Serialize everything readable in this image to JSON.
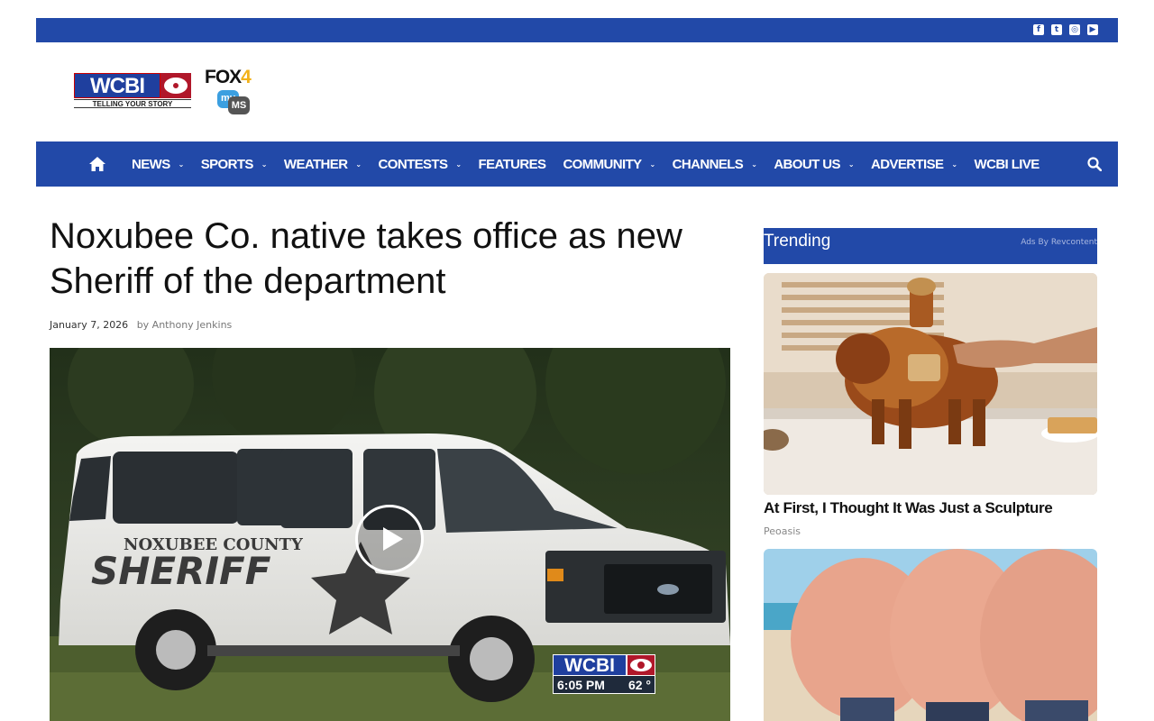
{
  "topbar": {
    "social_icons": [
      "facebook-icon",
      "twitter-icon",
      "instagram-icon",
      "youtube-icon"
    ]
  },
  "logos": {
    "wcbi": {
      "letters": "WCBI",
      "tagline": "TELLING YOUR STORY"
    },
    "fox": {
      "fox": "FOX",
      "four": "4",
      "my": "my",
      "ms": "MS"
    }
  },
  "nav": {
    "items": [
      {
        "label": "NEWS",
        "dropdown": true
      },
      {
        "label": "SPORTS",
        "dropdown": true
      },
      {
        "label": "WEATHER",
        "dropdown": true
      },
      {
        "label": "CONTESTS",
        "dropdown": true
      },
      {
        "label": "FEATURES",
        "dropdown": false
      },
      {
        "label": "COMMUNITY",
        "dropdown": true
      },
      {
        "label": "CHANNELS",
        "dropdown": true
      },
      {
        "label": "ABOUT US",
        "dropdown": true
      },
      {
        "label": "ADVERTISE",
        "dropdown": true
      },
      {
        "label": "WCBI LIVE",
        "dropdown": false
      }
    ],
    "chevron": "⌄"
  },
  "article": {
    "title": "Noxubee Co. native takes office as new Sheriff of the department",
    "date": "January 7, 2026",
    "byline": "by Anthony Jenkins",
    "video": {
      "van_county": "NOXUBEE COUNTY",
      "van_sheriff": "SHERIFF",
      "bug_logo": "WCBI",
      "bug_time": "6:05 PM",
      "bug_temp": "62 °"
    }
  },
  "sidebar": {
    "trending_label": "Trending",
    "ads_label": "Ads By Revcontent",
    "ads": [
      {
        "title": "At First, I Thought It Was Just a Sculpture",
        "source": "Peoasis"
      }
    ]
  },
  "colors": {
    "brand_blue": "#2249a8",
    "cbs_red": "#b0172a",
    "fox_gold": "#f2b21a"
  }
}
